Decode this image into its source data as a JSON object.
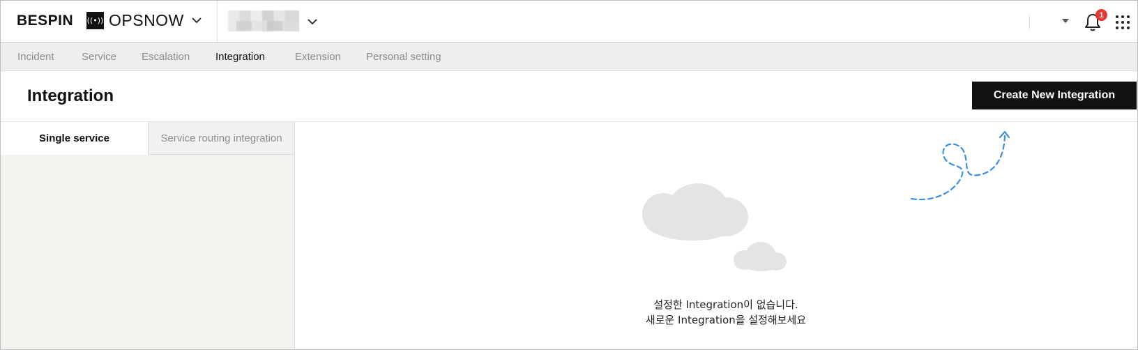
{
  "topbar": {
    "brand": "BESPIN",
    "product_icon_glyph": "((•))",
    "product": "OPSNOW",
    "notification_count": "1",
    "icons": {
      "product_menu": "chevron-down-icon",
      "project_menu": "chevron-down-icon",
      "user_menu": "caret-down-icon",
      "notifications": "bell-icon",
      "apps": "grid-icon"
    }
  },
  "nav": {
    "items": [
      {
        "label": "Incident",
        "active": false
      },
      {
        "label": "Service",
        "active": false
      },
      {
        "label": "Escalation",
        "active": false
      },
      {
        "label": "Integration",
        "active": true
      },
      {
        "label": "Extension",
        "active": false
      },
      {
        "label": "Personal setting",
        "active": false
      }
    ]
  },
  "page": {
    "title": "Integration",
    "create_button": "Create New Integration"
  },
  "tabs": [
    {
      "label": "Single service",
      "active": true
    },
    {
      "label": "Service routing integration",
      "active": false
    }
  ],
  "empty_state": {
    "line1": "설정한 Integration이 없습니다.",
    "line2": "새로운 Integration을 설정해보세요",
    "illustration": "cloud-icon",
    "pointer": "dashed-arrow-icon"
  },
  "colors": {
    "accent_arrow": "#3a8fe0",
    "badge": "#e53935",
    "button_bg": "#111111",
    "cloud": "#e4e4e4"
  }
}
